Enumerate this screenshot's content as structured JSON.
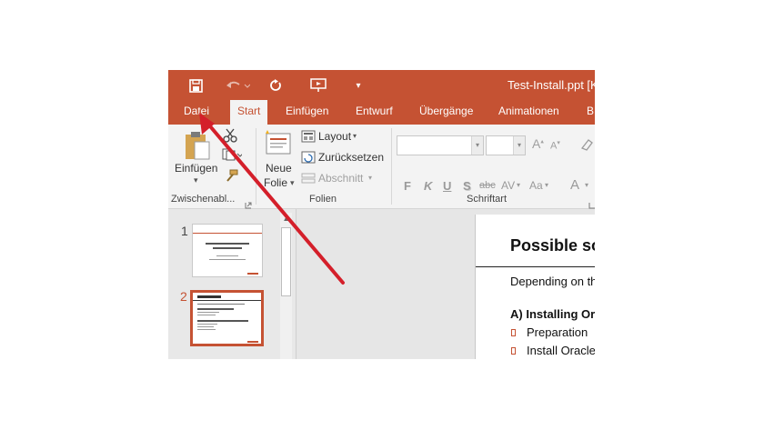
{
  "titlebar": {
    "doc_title": "Test-Install.ppt [K",
    "icons": [
      "save-icon",
      "undo-icon",
      "redo-icon",
      "start-from-beginning-icon",
      "customize-qat-icon"
    ]
  },
  "tabs": [
    "Datei",
    "Start",
    "Einfügen",
    "Entwurf",
    "Übergänge",
    "Animationen",
    "B"
  ],
  "ribbon": {
    "clipboard": {
      "paste_line1": "Einfügen",
      "paste_arrow": "▾",
      "group_label": "Zwischenabl..."
    },
    "slides": {
      "new_slide_line1": "Neue",
      "new_slide_line2": "Folie",
      "layout": "Layout",
      "reset": "Zurücksetzen",
      "section": "Abschnitt",
      "group_label": "Folien"
    },
    "font": {
      "buttons": [
        "F",
        "K",
        "U",
        "S",
        "abc",
        "AV",
        "Aa",
        "A"
      ],
      "grow": "A",
      "shrink": "A",
      "group_label": "Schriftart"
    }
  },
  "thumbnails": [
    {
      "number": "1",
      "selected": false
    },
    {
      "number": "2",
      "selected": true
    }
  ],
  "slide": {
    "title": "Possible so",
    "subtitle": "Depending on th",
    "section": "A) Installing Or",
    "bullets": [
      "Preparation",
      "Install Oracle"
    ]
  },
  "colors": {
    "accent": "#c55233",
    "arrow": "#d41f2a"
  }
}
